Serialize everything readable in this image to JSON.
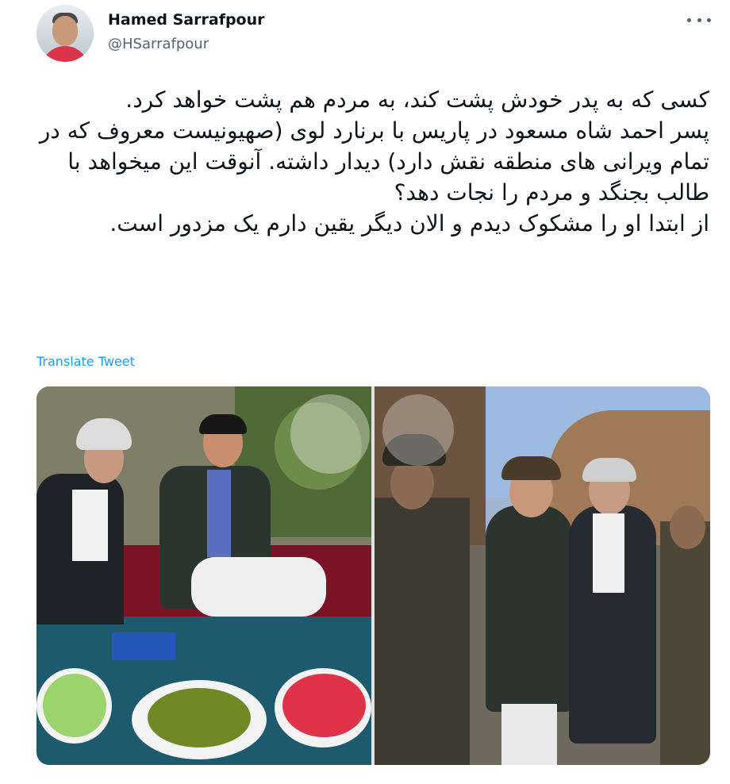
{
  "tweet": {
    "display_name": "Hamed Sarrafpour",
    "handle": "@HSarrafpour",
    "text": "کسی که به پدر خودش پشت کند، به مردم هم پشت خواهد کرد.\nپسر احمد شاه مسعود در پاریس با برنارد لوی (صهیونیست معروف که در تمام ویرانی های منطقه نقش دارد) دیدار داشته. آنوقت این میخواهد با طالب بجنگد و مردم را نجات دهد؟\nاز ابتدا او را مشکوک دیدم و الان دیگر یقین دارم یک مزدور است.",
    "translate_label": "Translate Tweet"
  },
  "icons": {
    "more": "more-horizontal-icon",
    "avatar": "profile-avatar"
  },
  "colors": {
    "link": "#1d9bf0",
    "secondary_text": "#536471",
    "primary_text": "#0f1419"
  }
}
